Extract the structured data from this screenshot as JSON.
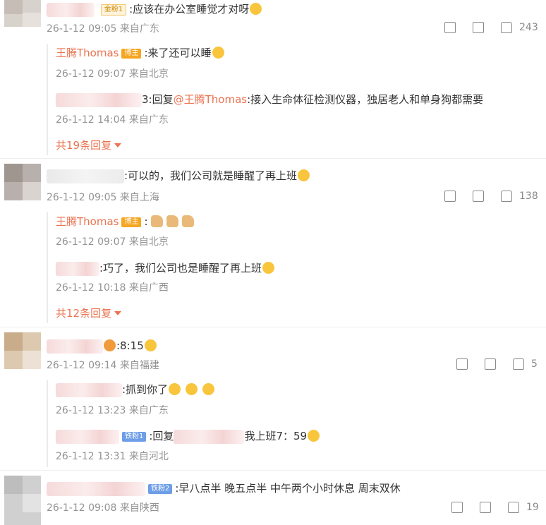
{
  "comments": [
    {
      "text": ":应该在办公室睡觉才对呀",
      "badge": "金粉1",
      "time": "26-1-12 09:05",
      "location": "来自广东",
      "likes": "243",
      "replies": [
        {
          "author": "王腾Thomas",
          "badge": "博主",
          "text": ":来了还可以睡",
          "time": "26-1-12 09:07",
          "location": "来自北京"
        },
        {
          "prefix": "3:回复",
          "mention": "@王腾Thomas",
          "text": ":接入生命体征检测仪器，独居老人和单身狗都需要",
          "time": "26-1-12 14:04",
          "location": "来自广东"
        }
      ],
      "more": "共19条回复"
    },
    {
      "text": ":可以的，我们公司就是睡醒了再上班",
      "time": "26-1-12 09:05",
      "location": "来自上海",
      "likes": "138",
      "replies": [
        {
          "author": "王腾Thomas",
          "badge": "博主",
          "text": ":",
          "time": "26-1-12 09:07",
          "location": "来自北京"
        },
        {
          "text": ":巧了，我们公司也是睡醒了再上班",
          "time": "26-1-12 10:18",
          "location": "来自广西"
        }
      ],
      "more": "共12条回复"
    },
    {
      "text": ":8:15",
      "time": "26-1-12 09:14",
      "location": "来自福建",
      "likes": "5",
      "replies": [
        {
          "text": ":抓到你了",
          "time": "26-1-12 13:23",
          "location": "来自广东"
        },
        {
          "badge": "铁粉1",
          "prefix": ":回复",
          "text": "我上班7：59",
          "time": "26-1-12 13:31",
          "location": "来自河北"
        }
      ]
    },
    {
      "text": ":早八点半 晚五点半 中午两个小时休息 周末双休",
      "badge": "铁粉2",
      "time": "26-1-12 09:08",
      "location": "来自陕西",
      "likes": "19"
    }
  ],
  "icons": [
    "share-icon",
    "comment-icon",
    "like-icon"
  ],
  "colors": {
    "link": "#eb7350",
    "meta": "#939393",
    "host_badge": "#f5a623",
    "iron_badge": "#6e9ee6"
  }
}
